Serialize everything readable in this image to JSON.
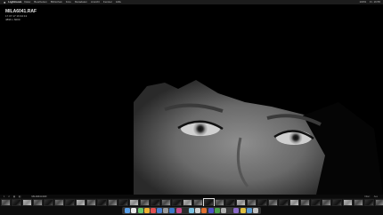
{
  "menubar": {
    "apple": "",
    "app": "Lightroom",
    "items": [
      "Datei",
      "Bearbeiten",
      "Bibliothek",
      "Foto",
      "Metadaten",
      "Ansicht",
      "Fenster",
      "Hilfe"
    ],
    "status": [
      "100%",
      "Fr. 16:55"
    ]
  },
  "photo_info": {
    "filename": "MILA6041.RAF",
    "datetime": "17.07.17 16:34:13",
    "dimensions": "4896 x 6000"
  },
  "toolstrip": {
    "left": [
      "1",
      "2",
      "▦",
      "◧"
    ],
    "filename": "MILA6041.RAF",
    "right": [
      "Filter:",
      "Aus"
    ]
  },
  "filmstrip": {
    "count": 40
  },
  "dock": {
    "icon_colors": [
      "#5aa0e8",
      "#e8e8e8",
      "#6ac46a",
      "#f0b030",
      "#e05050",
      "#4a7fd0",
      "#9a9a9a",
      "#3a78c8",
      "#c84a8a",
      "#2a2a2a",
      "#7ac0e0",
      "#d0d0d0",
      "#e07030",
      "#5050c8",
      "#4aa04a",
      "#b0b0b0",
      "#3a3a3a",
      "#8a6ac8",
      "#e0c040",
      "#5a9ad0",
      "#c0c0c0"
    ]
  }
}
